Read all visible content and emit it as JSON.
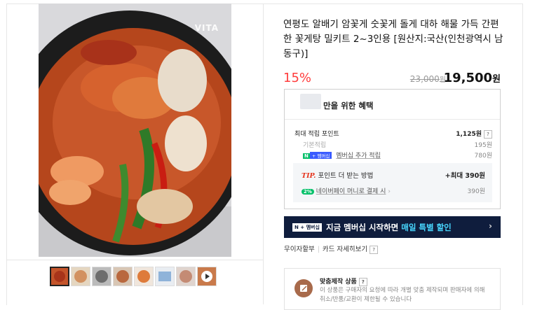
{
  "product": {
    "title": "연평도 알배기 암꽃게 숫꽃게 돌게 대하 해물 가득 간편한 꽃게탕 밀키트 2~3인용 [원산지:국산(인천광역시 남동구)]",
    "discount": "15%",
    "original_price": "23,000",
    "original_unit": "원",
    "final_price": "19,500",
    "final_unit": "원",
    "image_watermark": "VITA"
  },
  "benefits": {
    "title": "만을 위한 혜택",
    "max_points_label": "최대 적립 포인트",
    "max_points_value": "1,125원",
    "basic_label": "기본적립",
    "basic_value": "195원",
    "membership_badge_n": "N",
    "membership_badge_text": "+ 멤버십",
    "membership_label": "멤버십 추가 적립",
    "membership_value": "780원",
    "tip_label": "TIP.",
    "tip_text": "포인트 더 받는 방법",
    "tip_max": "+최대 390원",
    "pay_badge": "2%",
    "pay_label": "네이버페이 머니로 결제 시",
    "pay_value": "390원"
  },
  "banner": {
    "badge": "N + 멤버십",
    "text_prefix": "지금 멤버십 시작하면",
    "text_accent": "매일 특별 할인",
    "arrow": "›"
  },
  "links": {
    "interest_free": "무이자할부",
    "card_benefits": "카드 자세히보기"
  },
  "custom_order": {
    "title": "맞춤제작 상품",
    "desc": "이 상품은 구매자의 요청에 따라 개별 맞춤 제작되며 판매자에 의해 취소/반품/교환이 제한될 수 있습니다"
  },
  "icons": {
    "question": "?",
    "chevron": "›",
    "play": "▶"
  }
}
